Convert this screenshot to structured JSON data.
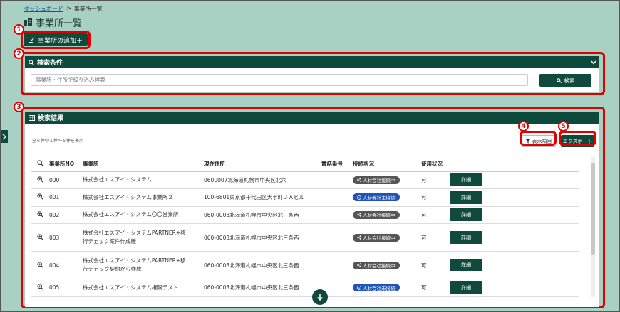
{
  "breadcrumb": {
    "home": "ダッシュボード",
    "separator": ">",
    "current": "事業所一覧"
  },
  "page_title": "事業所一覧",
  "add_button_label": "事業所の追加＋",
  "callouts": [
    "1",
    "2",
    "3",
    "4",
    "5"
  ],
  "search_panel": {
    "title": "検索条件",
    "placeholder": "事業所・住所で絞り込み検索",
    "search_button": "検索"
  },
  "results_panel": {
    "title": "検索結果",
    "count_text": "全６件中１件～６件を表示",
    "columns_button": "表示項目",
    "export_button": "エクスポート",
    "columns": [
      "事業所NO",
      "事業所",
      "現在住所",
      "電話番号",
      "接続状況",
      "使用状況"
    ],
    "detail_label": "詳細",
    "rows": [
      {
        "no": "000",
        "name": "株式会社エスアイ・システム",
        "name2": "",
        "address": "0600007北海道札幌市中央区北六",
        "tel": "",
        "status": "人材会社接続中",
        "status_type": "connected",
        "usage": "可"
      },
      {
        "no": "001",
        "name": "株式会社エスアイ・システム事業所２",
        "name2": "",
        "address": "100-6801東京都千代田区大手町ＪＡビル",
        "tel": "",
        "status": "人材会社未接続",
        "status_type": "notconnected",
        "usage": "可"
      },
      {
        "no": "002",
        "name": "株式会社エスアイ・システム〇〇営業所",
        "name2": "",
        "address": "060-0003北海道札幌市中央区北三条西",
        "tel": "",
        "status": "人材会社接続中",
        "status_type": "connected",
        "usage": "可"
      },
      {
        "no": "003",
        "name": "株式会社エスアイ・システムPARTNER+移",
        "name2": "行チェック案件作成版",
        "address": "060-0003北海道札幌市中央区北三条西",
        "tel": "",
        "status": "人材会社接続中",
        "status_type": "connected",
        "usage": "可"
      },
      {
        "no": "004",
        "name": "株式会社エスアイ・システムPARTNER+移",
        "name2": "行チェック契約から作成",
        "address": "060-0003北海道札幌市中央区北三条西",
        "tel": "",
        "status": "人材会社接続中",
        "status_type": "connected",
        "usage": "可"
      },
      {
        "no": "005",
        "name": "株式会社エスアイ・システム権限テスト",
        "name2": "",
        "address": "060-0003北海道札幌市中央区北三条西",
        "tel": "",
        "status": "人材会社未接続",
        "status_type": "notconnected",
        "usage": "可"
      }
    ]
  },
  "colors": {
    "primary": "#0e4a3c",
    "background": "#a9d1c3",
    "callout": "#e00000",
    "connected_badge": "#555555",
    "notconnected_badge": "#1f55b8"
  }
}
